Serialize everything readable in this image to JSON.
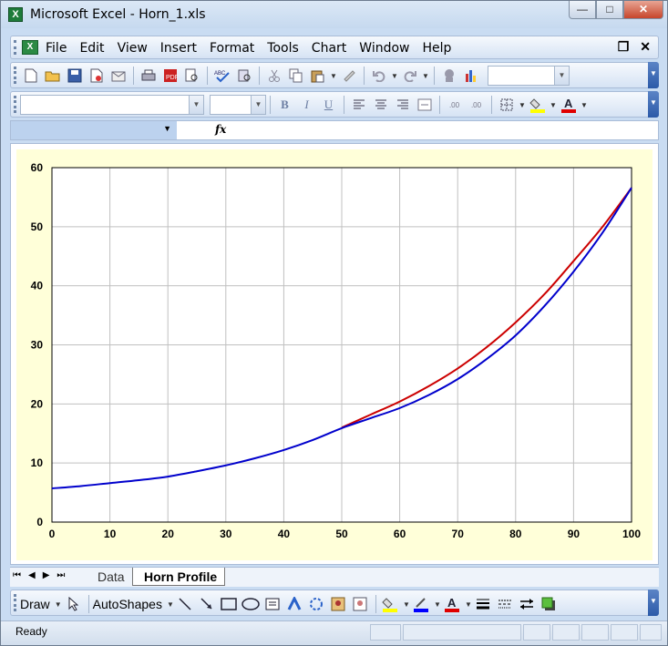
{
  "window": {
    "title": "Microsoft Excel - Horn_1.xls",
    "min_glyph": "—",
    "max_glyph": "□",
    "close_glyph": "✕"
  },
  "menubar": {
    "items": [
      "File",
      "Edit",
      "View",
      "Insert",
      "Format",
      "Tools",
      "Chart",
      "Window",
      "Help"
    ],
    "restore_glyph": "❐",
    "close_glyph": "✕"
  },
  "toolbar1": {
    "icons": [
      "new-icon",
      "open-icon",
      "save-icon",
      "permission-icon",
      "mail-icon",
      "print-icon",
      "print-preview-icon",
      "research-icon",
      "spelling-icon",
      "research-book-icon",
      "cut-icon",
      "copy-icon",
      "paste-icon",
      "format-painter-icon",
      "undo-icon",
      "redo-icon",
      "link-icon",
      "chart-wizard-icon"
    ],
    "zoom_value": ""
  },
  "toolbar2": {
    "font_value": "",
    "size_value": "",
    "bold": "B",
    "italic": "I",
    "underline": "U",
    "decimal_increase": ".00",
    "decimal_decrease": ".00",
    "fill_color": "#ffff00",
    "font_color": "#e00000"
  },
  "formula_bar": {
    "name_box": "",
    "fx": "fx",
    "formula": ""
  },
  "chart_data": {
    "type": "line",
    "title": "",
    "xlabel": "",
    "ylabel": "",
    "xlim": [
      0,
      100
    ],
    "ylim": [
      0,
      60
    ],
    "xticks": [
      0,
      10,
      20,
      30,
      40,
      50,
      60,
      70,
      80,
      90,
      100
    ],
    "yticks": [
      0,
      10,
      20,
      30,
      40,
      50,
      60
    ],
    "grid": true,
    "legend": "none",
    "colors": {
      "plot_bg": "#ffffff",
      "chart_bg": "#ffffd9",
      "grid": "#c0c0c0"
    },
    "series": [
      {
        "color": "#cc0000",
        "x": [
          50,
          55,
          60,
          65,
          70,
          75,
          80,
          85,
          90,
          95,
          100
        ],
        "y": [
          16.0,
          18.2,
          20.4,
          23.0,
          26.0,
          29.6,
          33.8,
          38.6,
          44.2,
          50.0,
          56.6
        ]
      },
      {
        "color": "#0000cc",
        "x": [
          0,
          5,
          10,
          15,
          20,
          25,
          30,
          35,
          40,
          45,
          50,
          55,
          60,
          65,
          70,
          75,
          80,
          85,
          90,
          95,
          100
        ],
        "y": [
          5.7,
          6.1,
          6.6,
          7.1,
          7.7,
          8.6,
          9.6,
          10.8,
          12.2,
          13.9,
          15.9,
          17.6,
          19.3,
          21.5,
          24.2,
          27.6,
          31.6,
          36.6,
          42.4,
          49.0,
          56.6
        ]
      }
    ]
  },
  "sheet_tabs": {
    "nav": [
      "⏮",
      "◀",
      "▶",
      "⏭"
    ],
    "tabs": [
      "Data",
      "Horn Profile"
    ],
    "active": "Horn Profile"
  },
  "drawbar": {
    "draw_label": "Draw",
    "autoshapes_label": "AutoShapes",
    "fill_color": "#ffff00",
    "line_color": "#0000ff",
    "font_color": "#e00000"
  },
  "status": {
    "text": "Ready"
  }
}
